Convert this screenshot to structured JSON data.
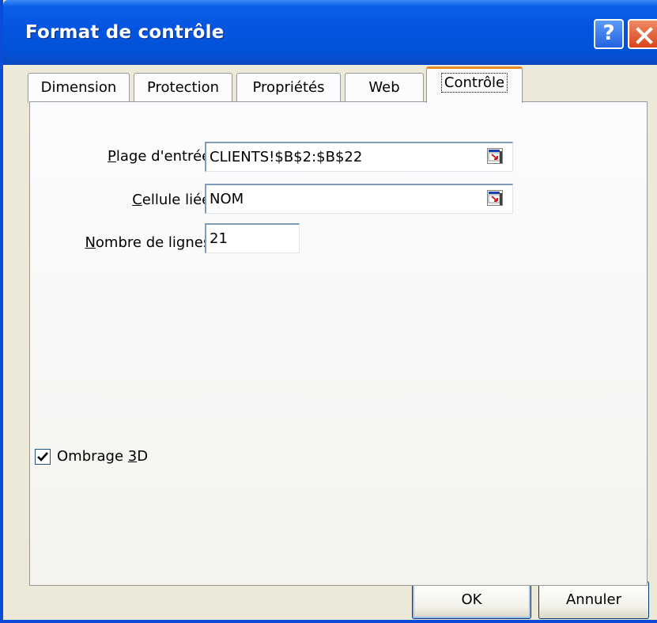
{
  "window": {
    "title": "Format de contrôle",
    "help_label": "?",
    "close_label": "×"
  },
  "tabs": [
    {
      "label": "Dimension"
    },
    {
      "label": "Protection"
    },
    {
      "label": "Propriétés"
    },
    {
      "label": "Web"
    },
    {
      "label": "Contrôle",
      "active": true
    }
  ],
  "form": {
    "input_range": {
      "label_accel": "P",
      "label_rest": "lage d'entrée :",
      "value": "CLIENTS!$B$2:$B$22"
    },
    "linked_cell": {
      "label_accel": "C",
      "label_rest": "ellule liée :",
      "value": "NOM"
    },
    "line_count": {
      "label_accel": "N",
      "label_rest": "ombre de lignes :",
      "value": "21"
    },
    "shading": {
      "label_pre": "Ombrage ",
      "label_accel": "3",
      "label_post": "D",
      "checked": true
    }
  },
  "buttons": {
    "ok": "OK",
    "cancel": "Annuler"
  },
  "colors": {
    "titlebar": "#0454e0",
    "active_tab_accent": "#e68b2c",
    "close_button": "#d9441c"
  }
}
